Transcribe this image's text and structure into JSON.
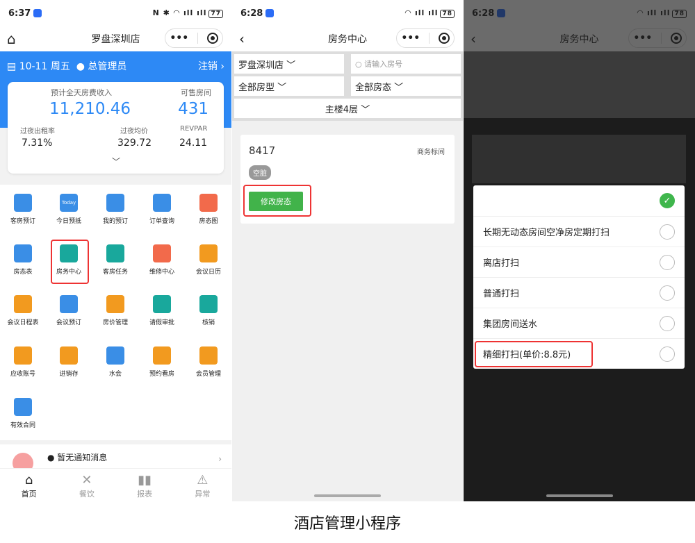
{
  "p1": {
    "time": "6:37",
    "battery": "77",
    "title": "罗盘深圳店",
    "date": "10-11 周五",
    "user": "总管理员",
    "logout": "注销",
    "kpi_left_label": "预计全天房费收入",
    "kpi_left_value": "11,210.46",
    "kpi_right_label": "可售房间",
    "kpi_right_value": "431",
    "m1_label": "过夜出租率",
    "m1_value": "7.31%",
    "m2_label": "过夜均价",
    "m2_value": "329.72",
    "m3_label": "REVPAR",
    "m3_value": "24.11",
    "grid": [
      "客房预订",
      "今日预抵",
      "我的预订",
      "订单查询",
      "房态图",
      "房态表",
      "房务中心",
      "客房任务",
      "维修中心",
      "会议日历",
      "会议日程表",
      "会议预订",
      "房价管理",
      "请假审批",
      "核销",
      "应收账号",
      "进销存",
      "水会",
      "预约看房",
      "会员管理",
      "有效合同"
    ],
    "today_badge": "Today",
    "notice": "● 暂无通知消息",
    "tabs": [
      "首页",
      "餐饮",
      "报表",
      "异常"
    ]
  },
  "p2": {
    "time": "6:28",
    "battery": "78",
    "title": "房务中心",
    "store": "罗盘深圳店",
    "search_placeholder": "请输入房号",
    "type": "全部房型",
    "state": "全部房态",
    "floor": "主楼4层",
    "room_no": "8417",
    "room_type": "商务标间",
    "room_state": "空脏",
    "modify_btn": "修改房态"
  },
  "p3": {
    "time": "6:28",
    "battery": "78",
    "title": "房务中心",
    "options": [
      "长期无动态房间空净房定期打扫",
      "离店打扫",
      "普通打扫",
      "集团房间送水",
      "精细打扫(单价:8.8元)"
    ]
  },
  "caption": "酒店管理小程序"
}
